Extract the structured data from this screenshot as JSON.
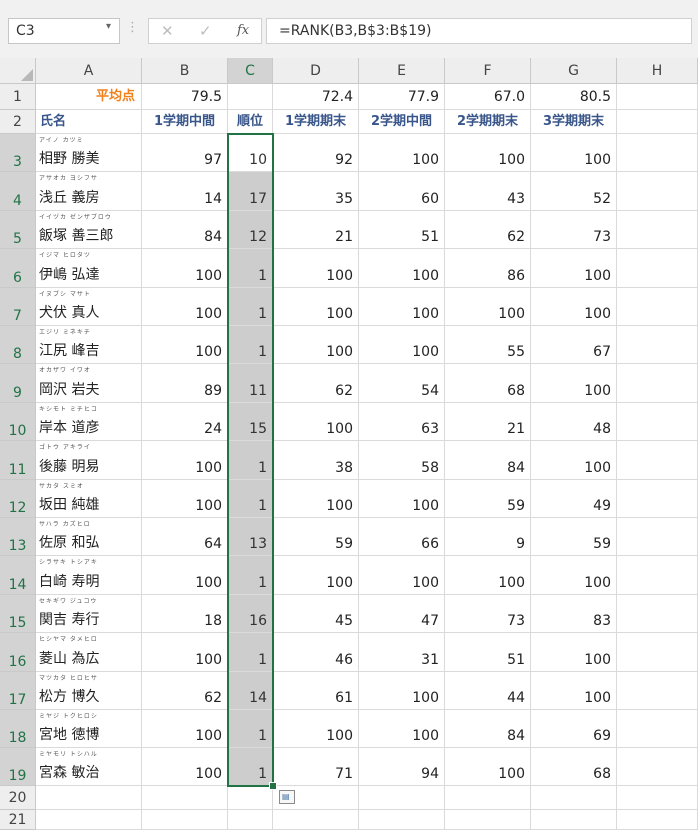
{
  "name_box": "C3",
  "formula": "=RANK(B3,B$3:B$19)",
  "icons": {
    "dropdown": "▾",
    "dots": "⋮",
    "cancel": "✕",
    "enter": "✓",
    "fx": "fx",
    "quick_analysis": "▤"
  },
  "columns": [
    "A",
    "B",
    "C",
    "D",
    "E",
    "F",
    "G",
    "H"
  ],
  "selected_column": "C",
  "row_numbers": [
    "1",
    "2",
    "3",
    "4",
    "5",
    "6",
    "7",
    "8",
    "9",
    "10",
    "11",
    "12",
    "13",
    "14",
    "15",
    "16",
    "17",
    "18",
    "19",
    "20",
    "21"
  ],
  "row1": {
    "label": "平均点",
    "values": [
      "79.5",
      "",
      "72.4",
      "77.9",
      "67.0",
      "80.5"
    ]
  },
  "headers": [
    "氏名",
    "1学期中間",
    "順位",
    "1学期期末",
    "2学期中間",
    "2学期期末",
    "3学期期末"
  ],
  "students": [
    {
      "furigana": "アイノ カツミ",
      "name": "相野 勝美",
      "mid1": "97",
      "rank": "10",
      "end1": "92",
      "mid2": "100",
      "end2": "100",
      "end3": "100"
    },
    {
      "furigana": "アサオカ ヨシフサ",
      "name": "浅丘 義房",
      "mid1": "14",
      "rank": "17",
      "end1": "35",
      "mid2": "60",
      "end2": "43",
      "end3": "52"
    },
    {
      "furigana": "イイヅカ ゼンザブロウ",
      "name": "飯塚 善三郎",
      "mid1": "84",
      "rank": "12",
      "end1": "21",
      "mid2": "51",
      "end2": "62",
      "end3": "73"
    },
    {
      "furigana": "イジマ ヒロタツ",
      "name": "伊嶋 弘達",
      "mid1": "100",
      "rank": "1",
      "end1": "100",
      "mid2": "100",
      "end2": "86",
      "end3": "100"
    },
    {
      "furigana": "イヌブシ マサト",
      "name": "犬伏 真人",
      "mid1": "100",
      "rank": "1",
      "end1": "100",
      "mid2": "100",
      "end2": "100",
      "end3": "100"
    },
    {
      "furigana": "エジリ ミネキチ",
      "name": "江尻 峰吉",
      "mid1": "100",
      "rank": "1",
      "end1": "100",
      "mid2": "100",
      "end2": "55",
      "end3": "67"
    },
    {
      "furigana": "オカザワ イワオ",
      "name": "岡沢 岩夫",
      "mid1": "89",
      "rank": "11",
      "end1": "62",
      "mid2": "54",
      "end2": "68",
      "end3": "100"
    },
    {
      "furigana": "キシモト ミチヒコ",
      "name": "岸本 道彦",
      "mid1": "24",
      "rank": "15",
      "end1": "100",
      "mid2": "63",
      "end2": "21",
      "end3": "48"
    },
    {
      "furigana": "ゴトウ アキライ",
      "name": "後藤 明易",
      "mid1": "100",
      "rank": "1",
      "end1": "38",
      "mid2": "58",
      "end2": "84",
      "end3": "100"
    },
    {
      "furigana": "サカタ スミオ",
      "name": "坂田 純雄",
      "mid1": "100",
      "rank": "1",
      "end1": "100",
      "mid2": "100",
      "end2": "59",
      "end3": "49"
    },
    {
      "furigana": "サハラ カズヒロ",
      "name": "佐原 和弘",
      "mid1": "64",
      "rank": "13",
      "end1": "59",
      "mid2": "66",
      "end2": "9",
      "end3": "59"
    },
    {
      "furigana": "シラサキ トシアキ",
      "name": "白崎 寿明",
      "mid1": "100",
      "rank": "1",
      "end1": "100",
      "mid2": "100",
      "end2": "100",
      "end3": "100"
    },
    {
      "furigana": "セキギワ ジュコウ",
      "name": "関吉 寿行",
      "mid1": "18",
      "rank": "16",
      "end1": "45",
      "mid2": "47",
      "end2": "73",
      "end3": "83"
    },
    {
      "furigana": "ヒシヤマ タメヒロ",
      "name": "菱山 為広",
      "mid1": "100",
      "rank": "1",
      "end1": "46",
      "mid2": "31",
      "end2": "51",
      "end3": "100"
    },
    {
      "furigana": "マツカタ ヒロヒサ",
      "name": "松方 博久",
      "mid1": "62",
      "rank": "14",
      "end1": "61",
      "mid2": "100",
      "end2": "44",
      "end3": "100"
    },
    {
      "furigana": "ミヤジ トクヒロシ",
      "name": "宮地 徳博",
      "mid1": "100",
      "rank": "1",
      "end1": "100",
      "mid2": "100",
      "end2": "84",
      "end3": "69"
    },
    {
      "furigana": "ミヤモリ トシハル",
      "name": "宮森 敏治",
      "mid1": "100",
      "rank": "1",
      "end1": "71",
      "mid2": "94",
      "end2": "100",
      "end3": "68"
    }
  ]
}
